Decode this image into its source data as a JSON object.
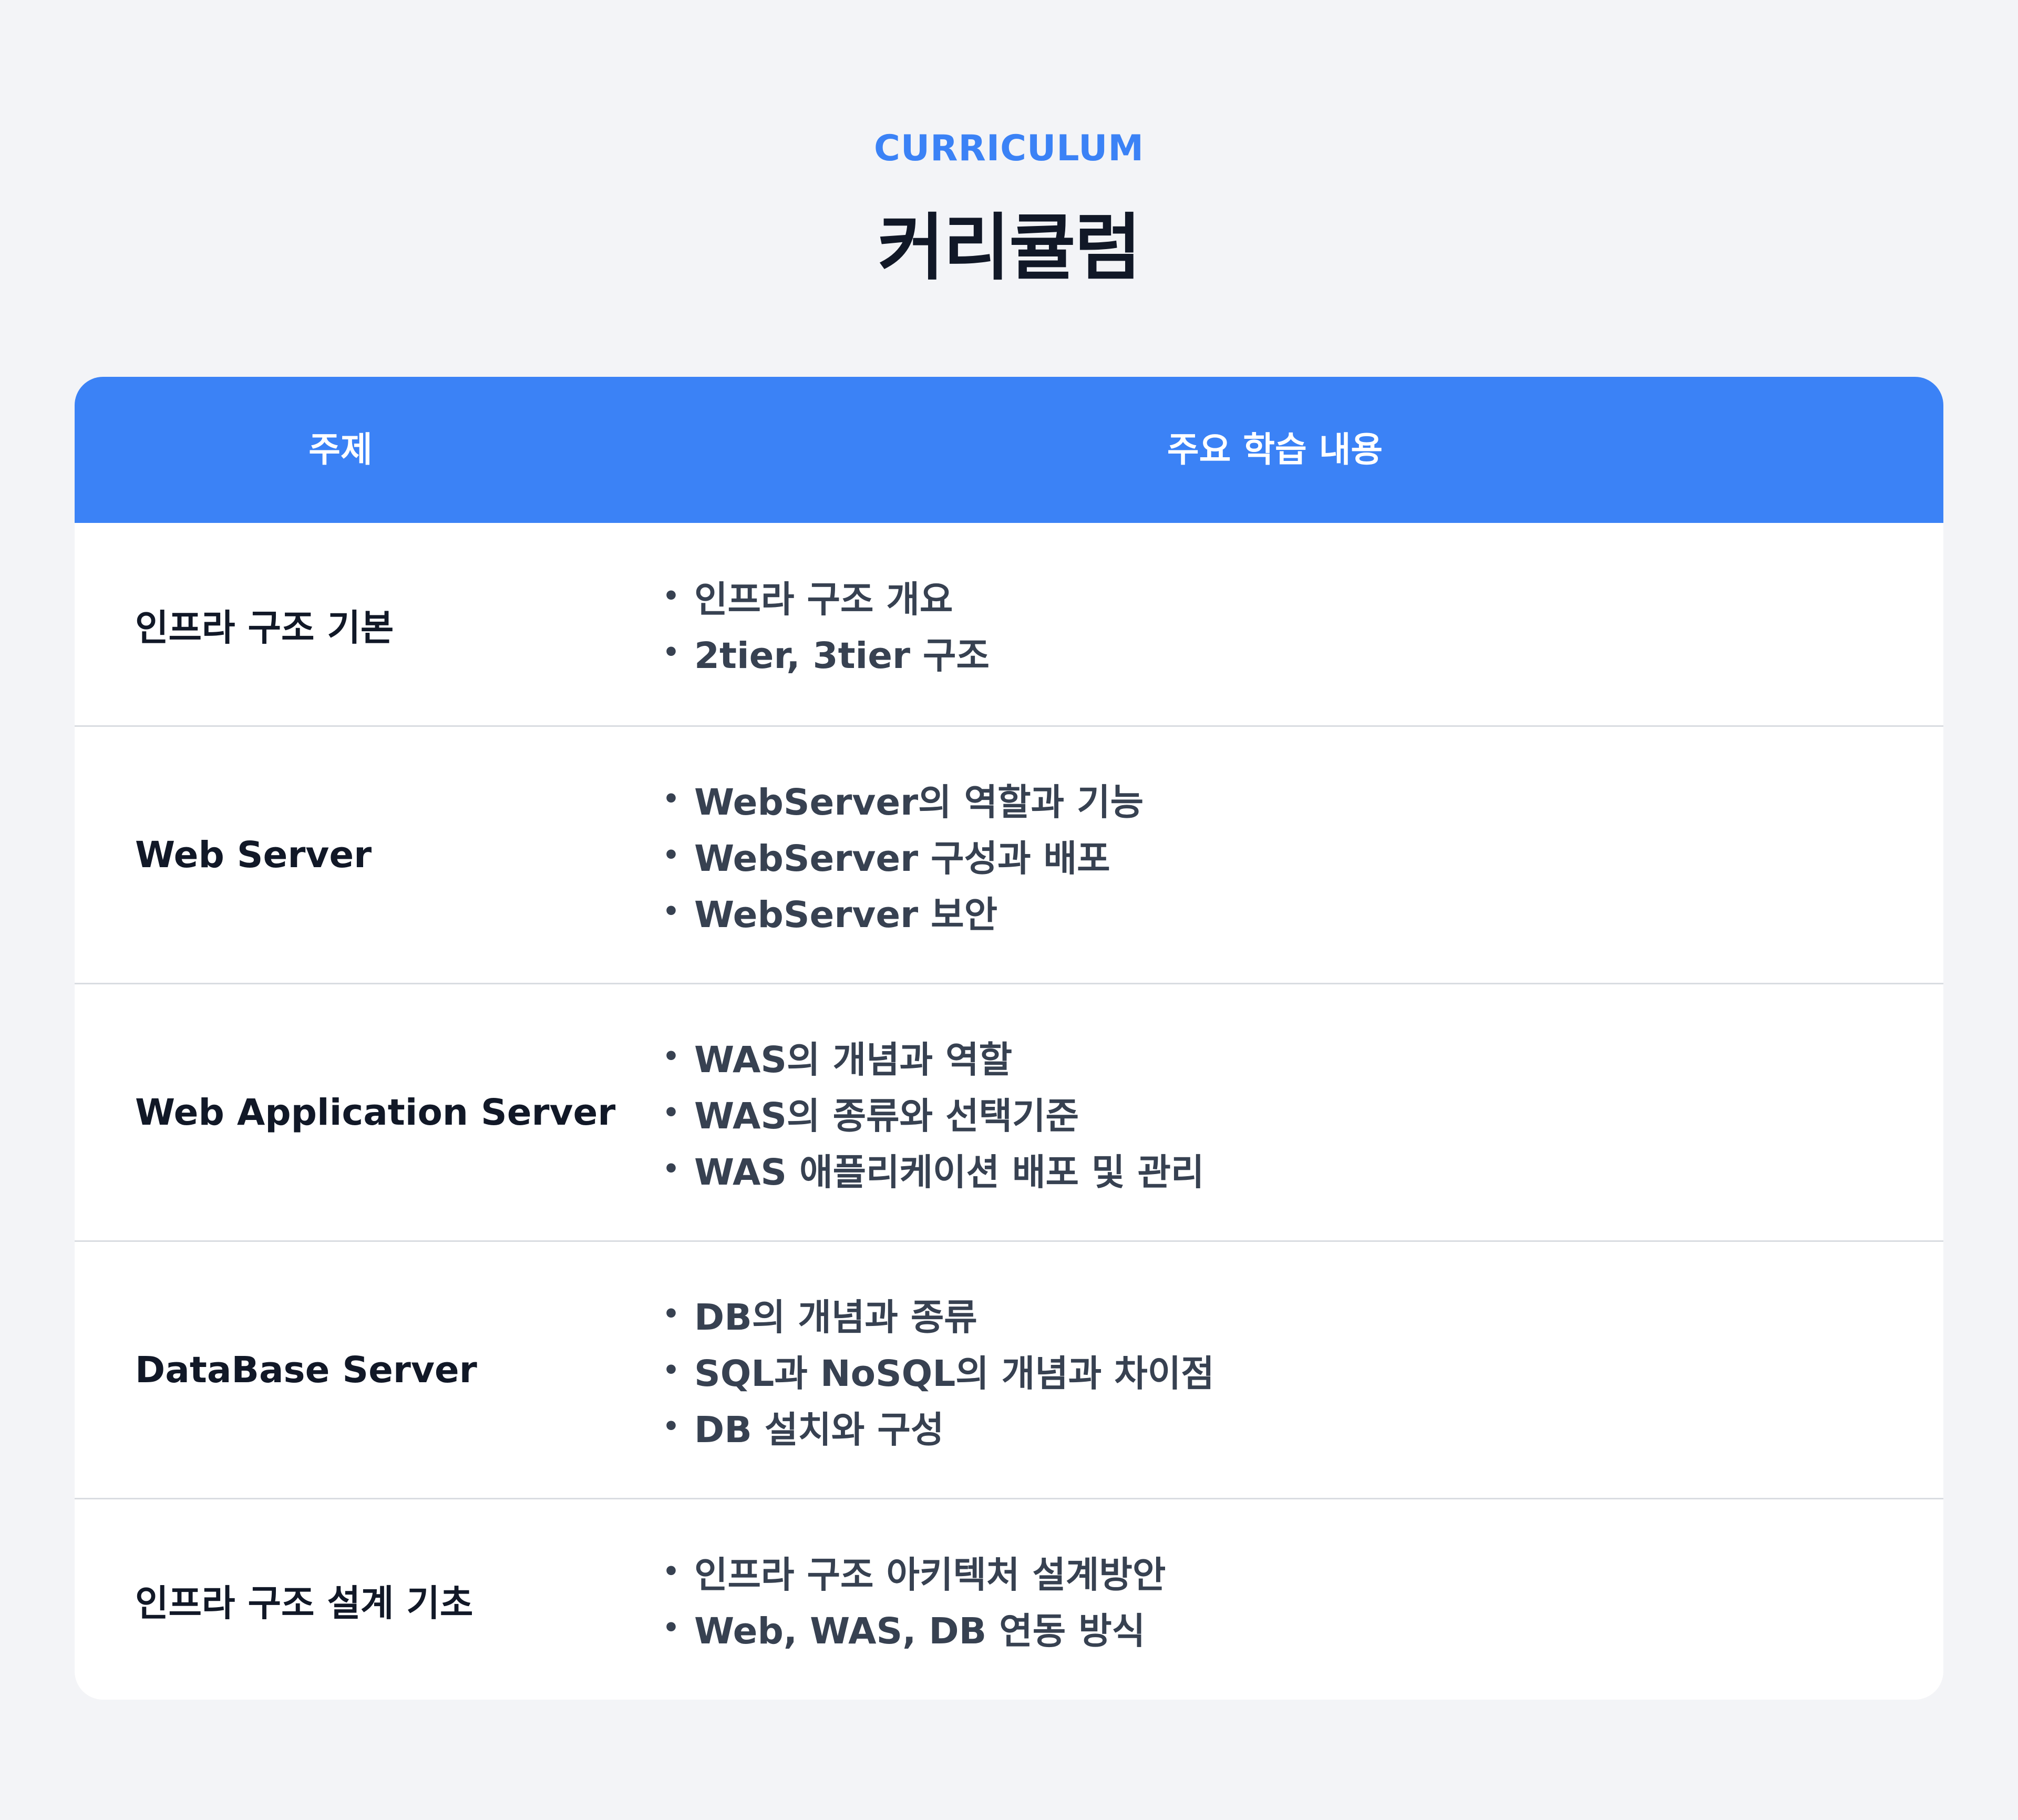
{
  "section": {
    "eyebrow": "CURRICULUM",
    "title": "커리큘럼"
  },
  "table": {
    "headers": {
      "topic": "주제",
      "content": "주요 학습 내용"
    },
    "rows": [
      {
        "topic": "인프라 구조 기본",
        "items": [
          "인프라 구조 개요",
          "2tier, 3tier 구조"
        ]
      },
      {
        "topic": "Web Server",
        "items": [
          "WebServer의 역할과 기능",
          "WebServer 구성과 배포",
          "WebServer 보안"
        ]
      },
      {
        "topic": "Web Application Server",
        "items": [
          "WAS의 개념과 역할",
          "WAS의 종류와 선택기준",
          "WAS 애플리케이션 배포 및 관리"
        ]
      },
      {
        "topic": "DataBase Server",
        "items": [
          "DB의 개념과 종류",
          "SQL과 NoSQL의 개념과 차이점",
          "DB 설치와 구성"
        ]
      },
      {
        "topic": "인프라 구조 설계 기초",
        "items": [
          "인프라 구조 아키텍처 설계방안",
          "Web, WAS, DB 연동 방식"
        ]
      }
    ]
  },
  "colors": {
    "accent": "#3b82f6",
    "background": "#f3f4f7",
    "title": "#111827",
    "item_text": "#374151",
    "divider": "#d9dce1"
  },
  "icons": {
    "bullet": "bullet-dot-icon"
  }
}
